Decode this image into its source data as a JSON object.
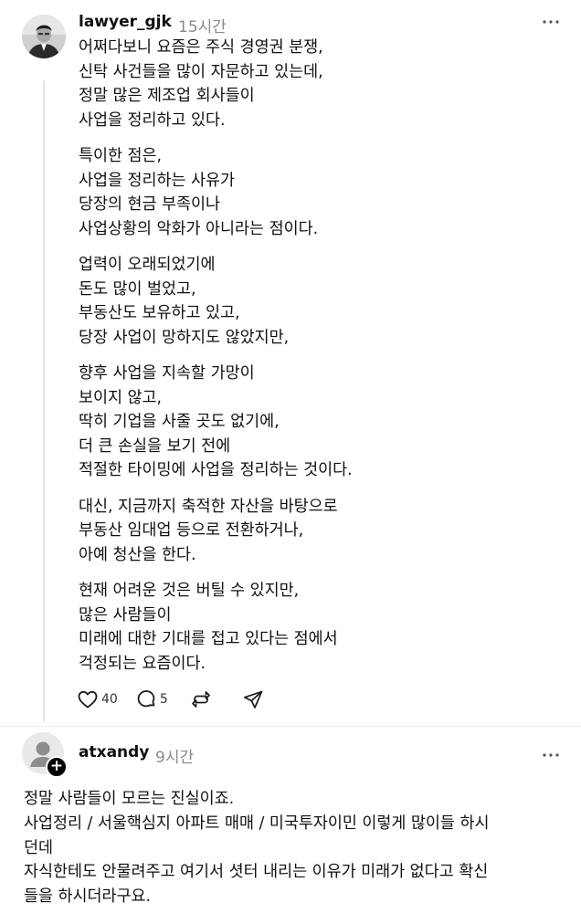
{
  "post": {
    "username": "lawyer_gjk",
    "time": "15시간",
    "paragraphs": [
      [
        "어쩌다보니 요즘은 주식 경영권 분쟁,",
        "신탁 사건들을 많이 자문하고 있는데,",
        "정말 많은 제조업 회사들이",
        "사업을 정리하고 있다."
      ],
      [
        "특이한 점은,",
        "사업을 정리하는 사유가",
        "당장의 현금 부족이나",
        "사업상황의 악화가 아니라는 점이다."
      ],
      [
        "업력이 오래되었기에",
        "돈도 많이 벌었고,",
        "부동산도 보유하고 있고,",
        "당장 사업이 망하지도 않았지만,"
      ],
      [
        "향후 사업을 지속할 가망이",
        "보이지 않고,",
        "딱히 기업을 사줄 곳도 없기에,",
        "더 큰 손실을 보기 전에",
        "적절한 타이밍에 사업을 정리하는 것이다."
      ],
      [
        "대신, 지금까지 축적한 자산을 바탕으로",
        "부동산 임대업 등으로 전환하거나,",
        "아예 청산을 한다."
      ],
      [
        "현재 어려운 것은 버틸 수 있지만,",
        "많은 사람들이",
        "미래에 대한 기대를 접고 있다는 점에서",
        "걱정되는 요즘이다."
      ]
    ],
    "likes": "40",
    "comments": "5"
  },
  "reply": {
    "username": "atxandy",
    "time": "9시간",
    "lines": [
      "정말 사람들이 모르는 진실이죠.",
      "사업정리 / 서울핵심지 아파트 매매 / 미국투자이민 이렇게 많이들 하시",
      "던데",
      "자식한테도 안물려주고 여기서 셧터 내리는 이유가 미래가 없다고 확신",
      "들을 하시더라구요."
    ]
  },
  "icons": {
    "like": "heart-icon",
    "comment": "comment-bubble-icon",
    "repost": "repost-icon",
    "share": "send-icon",
    "more": "more-dots-icon",
    "follow": "plus-icon"
  }
}
